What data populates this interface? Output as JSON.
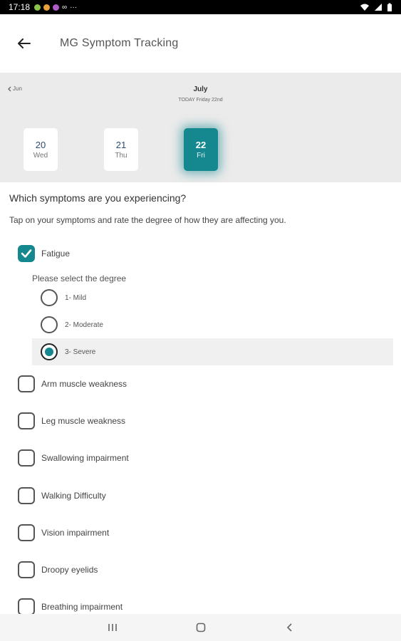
{
  "status_bar": {
    "time": "17:18",
    "overflow": "···"
  },
  "header": {
    "title": "MG Symptom Tracking",
    "back_icon": "arrow-left-icon"
  },
  "calendar": {
    "prev_label": "Jun",
    "month": "July",
    "today_label": "TODAY Friday 22nd",
    "days": [
      {
        "num": "20",
        "dow": "Wed"
      },
      {
        "num": "21",
        "dow": "Thu"
      },
      {
        "num": "22",
        "dow": "Fri",
        "selected": true
      }
    ]
  },
  "question": "Which symptoms are you experiencing?",
  "instruction": "Tap on your symptoms and rate the degree of how they are affecting you.",
  "symptoms": [
    {
      "label": "Fatigue",
      "checked": true
    },
    {
      "label": "Arm muscle weakness",
      "checked": false
    },
    {
      "label": "Leg muscle weakness",
      "checked": false
    },
    {
      "label": "Swallowing impairment",
      "checked": false
    },
    {
      "label": "Walking Difficulty",
      "checked": false
    },
    {
      "label": "Vision impairment",
      "checked": false
    },
    {
      "label": "Droopy eyelids",
      "checked": false
    },
    {
      "label": "Breathing impairment",
      "checked": false
    }
  ],
  "degree": {
    "prompt": "Please select the degree",
    "options": [
      "1- Mild",
      "2- Moderate",
      "3- Severe"
    ],
    "selected_option": "3- Severe"
  },
  "colors": {
    "accent": "#14878f",
    "calendar_bg": "#ebebeb"
  }
}
